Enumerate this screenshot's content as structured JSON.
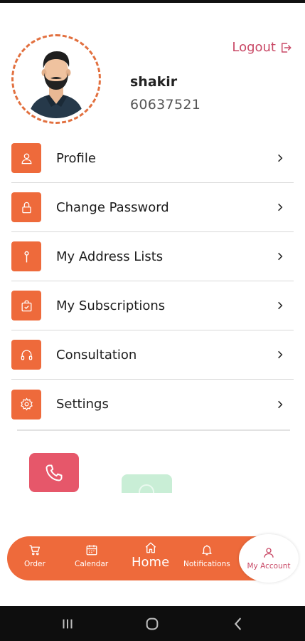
{
  "profile": {
    "name": "shakir",
    "phone": "60637521",
    "avatar_icon": "user-avatar-icon",
    "ring_color": "#e2703f"
  },
  "logout": {
    "label": "Logout",
    "icon": "logout-icon",
    "color": "#c94966"
  },
  "menu": {
    "accent": "#ee6a3b",
    "items": [
      {
        "label": "Profile",
        "icon": "user-icon"
      },
      {
        "label": "Change Password",
        "icon": "lock-icon"
      },
      {
        "label": "My Address Lists",
        "icon": "pin-icon"
      },
      {
        "label": "My Subscriptions",
        "icon": "subscription-bag-icon"
      },
      {
        "label": "Consultation",
        "icon": "headphones-icon"
      },
      {
        "label": "Settings",
        "icon": "gear-icon"
      }
    ]
  },
  "floating": {
    "call_icon": "phone-icon",
    "call_color": "#e6576a",
    "whatsapp_icon": "whatsapp-icon",
    "whatsapp_color": "#c9eed6"
  },
  "bottom_nav": {
    "items": [
      {
        "label": "Order",
        "icon": "cart-icon"
      },
      {
        "label": "Calendar",
        "icon": "calendar-icon"
      },
      {
        "label": "Home",
        "icon": "home-icon"
      },
      {
        "label": "Notifications",
        "icon": "bell-icon"
      },
      {
        "label": "My Account",
        "icon": "user-icon",
        "active": true
      }
    ]
  },
  "system_nav": {
    "items": [
      "recents-icon",
      "home-circle-icon",
      "back-icon"
    ]
  }
}
